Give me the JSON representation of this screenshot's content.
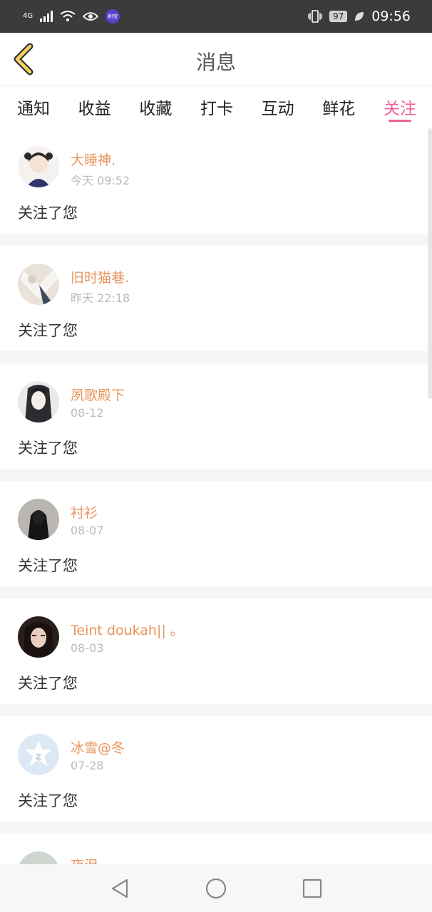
{
  "status_bar": {
    "network": "4G",
    "badge": "刷宝",
    "battery": "97",
    "time": "09:56"
  },
  "header": {
    "title": "消息"
  },
  "tabs": [
    {
      "label": "通知",
      "active": false
    },
    {
      "label": "收益",
      "active": false
    },
    {
      "label": "收藏",
      "active": false
    },
    {
      "label": "打卡",
      "active": false
    },
    {
      "label": "互动",
      "active": false
    },
    {
      "label": "鲜花",
      "active": false
    },
    {
      "label": "关注",
      "active": true
    }
  ],
  "messages": [
    {
      "name": "大睡神.",
      "time": "今天 09:52",
      "text": "关注了您"
    },
    {
      "name": "旧时猫巷.",
      "time": "昨天 22:18",
      "text": "关注了您"
    },
    {
      "name": "夙歌殿下",
      "time": "08-12",
      "text": "关注了您"
    },
    {
      "name": "衬衫",
      "time": "08-07",
      "text": "关注了您"
    },
    {
      "name": "Teint doukah|| 。",
      "time": "08-03",
      "text": "关注了您"
    },
    {
      "name": "冰雪@冬",
      "time": "07-28",
      "text": "关注了您"
    },
    {
      "name": "夜泪",
      "time": "",
      "text": ""
    }
  ],
  "colors": {
    "accent": "#f0609a",
    "username": "#e8945c",
    "back_arrow": "#f4d35e"
  }
}
